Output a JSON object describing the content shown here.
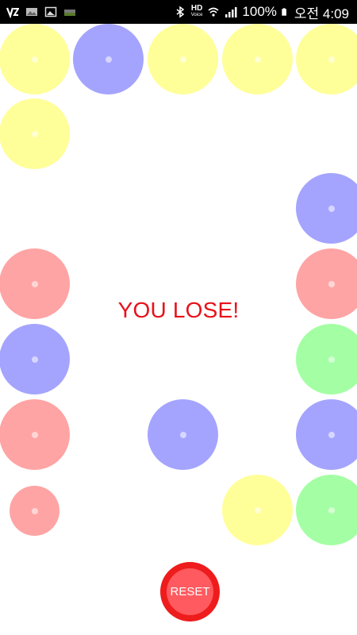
{
  "status_bar": {
    "battery_text": "100%",
    "time_text": "오전 4:09",
    "hd_label": "HD",
    "hd_sub": "Voice",
    "icons": [
      "vibe-app-icon",
      "gallery-icon",
      "image-icon",
      "data-icon",
      "bluetooth-icon",
      "hd-voice-icon",
      "wifi-icon",
      "signal-icon",
      "battery-icon"
    ]
  },
  "game": {
    "result_text": "YOU LOSE!",
    "reset_label": "RESET",
    "colors": {
      "yellow": "#ffff99",
      "blue": "#a4a4ff",
      "red": "#ffa4a4",
      "green": "#a4ffa4"
    },
    "balls": [
      {
        "color": "yellow"
      },
      {
        "color": "blue"
      },
      {
        "color": "yellow"
      },
      {
        "color": "yellow"
      },
      {
        "color": "yellow"
      },
      {
        "color": "yellow"
      },
      {
        "color": "blue"
      },
      {
        "color": "red"
      },
      {
        "color": "red"
      },
      {
        "color": "blue"
      },
      {
        "color": "green"
      },
      {
        "color": "red"
      },
      {
        "color": "blue"
      },
      {
        "color": "blue"
      },
      {
        "color": "red"
      },
      {
        "color": "yellow"
      },
      {
        "color": "green"
      }
    ]
  }
}
